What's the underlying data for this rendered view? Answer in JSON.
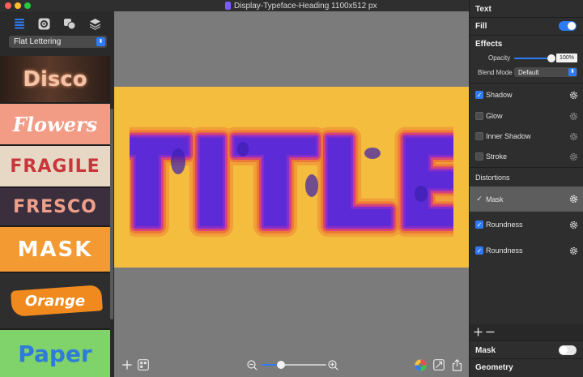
{
  "window": {
    "document_title": "Display-Typeface-Heading 1100x512 px"
  },
  "sidebar": {
    "toolbar_icons": [
      "list-icon",
      "gear-square-icon",
      "shapes-icon",
      "layers-icon"
    ],
    "preset_select": {
      "value": "Flat Lettering"
    },
    "presets": [
      {
        "label": "Disco",
        "bg": "#3a2a22",
        "fg": "#f0c0a0"
      },
      {
        "label": "Flowers",
        "bg": "#f29c86",
        "fg": "#ffffff"
      },
      {
        "label": "FRAGILE",
        "bg": "#e6d8c4",
        "fg": "#c8353a"
      },
      {
        "label": "FRESCO",
        "bg": "#3b2f3d",
        "fg": "#f0a08a"
      },
      {
        "label": "MASK",
        "bg": "#f39a33",
        "fg": "#ffffff"
      },
      {
        "label": "Orange",
        "bg": "#2e2e2e",
        "fg": "#ffffff"
      },
      {
        "label": "Paper",
        "bg": "#7fd36a",
        "fg": "#2f7bd8"
      }
    ]
  },
  "canvas": {
    "artboard_text": "TITLE",
    "artboard_color": "#f5bd3d",
    "zoom_fraction": 0.3
  },
  "bottom_toolbar": {
    "icons": [
      "plus-icon",
      "grid-icon",
      "zoom-out-icon",
      "zoom-in-icon",
      "color-wheel-icon",
      "crop-icon",
      "share-icon"
    ]
  },
  "inspector": {
    "text_section": "Text",
    "fill_label": "Fill",
    "fill_on": true,
    "effects_section": "Effects",
    "opacity_label": "Opacity",
    "opacity_value": "100%",
    "blend_mode_label": "Blend Mode",
    "blend_mode_value": "Default",
    "effects": [
      {
        "label": "Shadow",
        "checked": true
      },
      {
        "label": "Glow",
        "checked": false
      },
      {
        "label": "Inner Shadow",
        "checked": false
      },
      {
        "label": "Stroke",
        "checked": false
      }
    ],
    "distortions_section": "Distortions",
    "distortions": [
      {
        "label": "Mask",
        "checked": true,
        "selected": true
      },
      {
        "label": "Roundness",
        "checked": true,
        "selected": false
      },
      {
        "label": "Roundness",
        "checked": true,
        "selected": false
      }
    ],
    "mask_label": "Mask",
    "mask_on": false,
    "geometry_section": "Geometry"
  },
  "colors": {
    "accent": "#2f7bf5",
    "sidebar_bg": "#2a2a2a",
    "canvas_bg": "#7b7b7b"
  }
}
